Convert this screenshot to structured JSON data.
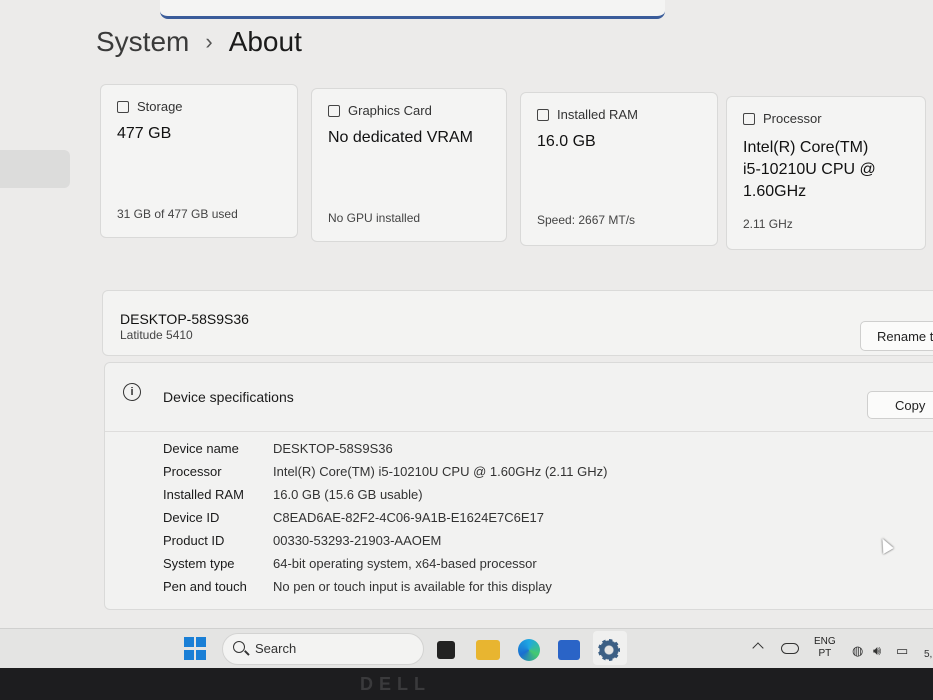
{
  "breadcrumb": {
    "parent": "System",
    "separator": "›",
    "current": "About"
  },
  "cards": [
    {
      "title": "Storage",
      "icon": "storage-icon",
      "value_lines": [
        "477 GB"
      ],
      "footer": "31 GB of 477 GB used"
    },
    {
      "title": "Graphics Card",
      "icon": "graphics-card-icon",
      "value_lines": [
        "No dedicated VRAM"
      ],
      "footer": "No GPU installed"
    },
    {
      "title": "Installed RAM",
      "icon": "ram-icon",
      "value_lines": [
        "16.0 GB"
      ],
      "footer": "Speed: 2667 MT/s"
    },
    {
      "title": "Processor",
      "icon": "processor-icon",
      "value_lines": [
        "Intel(R) Core(TM)",
        "i5-10210U CPU @",
        "1.60GHz"
      ],
      "footer": "2.11 GHz"
    }
  ],
  "device": {
    "name": "DESKTOP-58S9S36",
    "model": "Latitude 5410",
    "rename_label": "Rename t"
  },
  "specs": {
    "title": "Device specifications",
    "copy_label": "Copy",
    "rows": [
      {
        "label": "Device name",
        "value": "DESKTOP-58S9S36"
      },
      {
        "label": "Processor",
        "value": "Intel(R) Core(TM) i5-10210U CPU @ 1.60GHz (2.11 GHz)"
      },
      {
        "label": "Installed RAM",
        "value": "16.0 GB (15.6 GB usable)"
      },
      {
        "label": "Device ID",
        "value": "C8EAD6AE-82F2-4C06-9A1B-E1624E7C6E17"
      },
      {
        "label": "Product ID",
        "value": "00330-53293-21903-AAOEM"
      },
      {
        "label": "System type",
        "value": "64-bit operating system, x64-based processor"
      },
      {
        "label": "Pen and touch",
        "value": "No pen or touch input is available for this display"
      }
    ]
  },
  "taskbar": {
    "search_label": "Search",
    "lang_top": "ENG",
    "lang_bottom": "PT",
    "date_fragment": "5,",
    "apps": [
      "task-view-icon",
      "file-explorer-icon",
      "edge-icon",
      "store-icon",
      "settings-icon"
    ]
  },
  "bezel_brand": "DELL",
  "colors": {
    "accent": "#1a7fd6",
    "background": "#ecebea",
    "card": "#f4f4f3"
  }
}
